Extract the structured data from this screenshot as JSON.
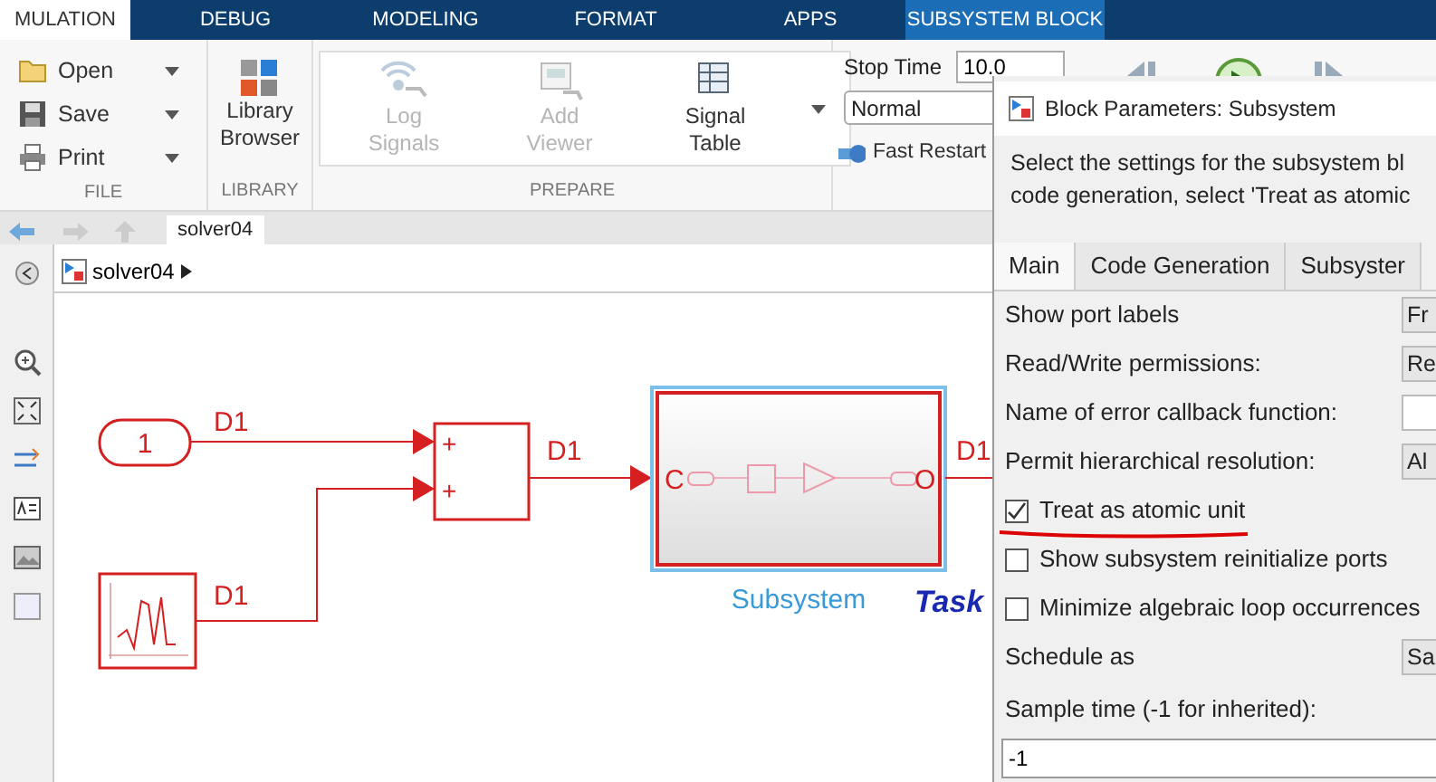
{
  "ribbon_tabs": [
    {
      "label": "MULATION",
      "selected": true,
      "kind": "standard"
    },
    {
      "label": "DEBUG",
      "selected": false,
      "kind": "standard"
    },
    {
      "label": "MODELING",
      "selected": false,
      "kind": "standard"
    },
    {
      "label": "FORMAT",
      "selected": false,
      "kind": "standard"
    },
    {
      "label": "APPS",
      "selected": false,
      "kind": "standard"
    },
    {
      "label": "SUBSYSTEM BLOCK",
      "selected": false,
      "kind": "contextual"
    }
  ],
  "file_section": {
    "title": "FILE",
    "items": [
      {
        "label": "Open",
        "kind": "open"
      },
      {
        "label": "Save",
        "kind": "save"
      },
      {
        "label": "Print",
        "kind": "print"
      }
    ]
  },
  "library_section": {
    "title": "LIBRARY",
    "button": [
      "Library",
      "Browser"
    ]
  },
  "prepare_section": {
    "title": "PREPARE",
    "items": [
      {
        "lines": [
          "Log",
          "Signals"
        ],
        "kind": "log",
        "disabled": true
      },
      {
        "lines": [
          "Add",
          "Viewer"
        ],
        "kind": "viewer",
        "disabled": true
      },
      {
        "lines": [
          "Signal",
          "Table"
        ],
        "kind": "table",
        "disabled": false
      }
    ]
  },
  "simulate_section": {
    "stop_time_label": "Stop Time",
    "stop_time": "10.0",
    "mode": "Normal",
    "fast_restart": "Fast Restart"
  },
  "address_bar": {
    "tab": "solver04",
    "breadcrumb": "solver04"
  },
  "diagram": {
    "constant_value": "1",
    "sum_signs": [
      "+",
      "+"
    ],
    "input_port": "C",
    "output_port": "O",
    "subsystem_name": "Subsystem",
    "task_label": "Task",
    "signal_labels": [
      "D1",
      "D1",
      "D1",
      "D1"
    ]
  },
  "dialog": {
    "title": "Block Parameters: Subsystem",
    "description": [
      "Select the settings for the subsystem bl",
      "code generation, select 'Treat as atomic"
    ],
    "tabs": [
      {
        "label": "Main",
        "selected": true
      },
      {
        "label": "Code Generation",
        "selected": false
      },
      {
        "label": "Subsyster",
        "selected": false
      }
    ],
    "params": [
      {
        "kind": "dropdown",
        "label": "Show port labels",
        "value": "Fr"
      },
      {
        "kind": "dropdown",
        "label": "Read/Write permissions:",
        "value": "Re"
      },
      {
        "kind": "text",
        "label": "Name of error callback function:"
      },
      {
        "kind": "dropdown",
        "label": "Permit hierarchical resolution:",
        "value": "Al"
      },
      {
        "kind": "checkbox",
        "label": "Treat as atomic unit",
        "checked": true,
        "underlined": true
      },
      {
        "kind": "checkbox",
        "label": "Show subsystem reinitialize ports",
        "checked": false
      },
      {
        "kind": "checkbox",
        "label": "Minimize algebraic loop occurrences",
        "checked": false
      },
      {
        "kind": "dropdown",
        "label": "Schedule as",
        "value": "Sa"
      }
    ],
    "sample_time": {
      "label": "Sample time (-1 for inherited):",
      "value": "-1"
    }
  }
}
